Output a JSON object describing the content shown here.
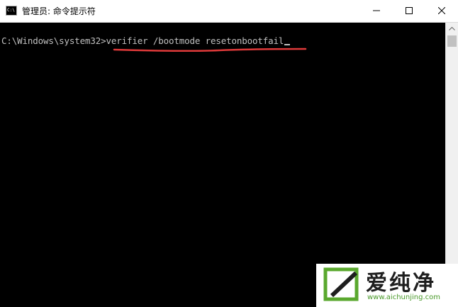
{
  "window": {
    "title": "管理员: 命令提示符",
    "icon_text": "C:\\"
  },
  "console": {
    "prompt": "C:\\Windows\\system32>",
    "command": "verifier /bootmode resetonbootfail",
    "underline_color": "#e03a3a"
  },
  "watermark": {
    "brand": "爱纯净",
    "url": "www.aichunjing.com"
  },
  "colors": {
    "console_bg": "#000000",
    "console_text": "#c0c0c0",
    "titlebar_bg": "#ffffff",
    "accent_frame": "#f0c400",
    "logo_green": "#5aa82e"
  }
}
